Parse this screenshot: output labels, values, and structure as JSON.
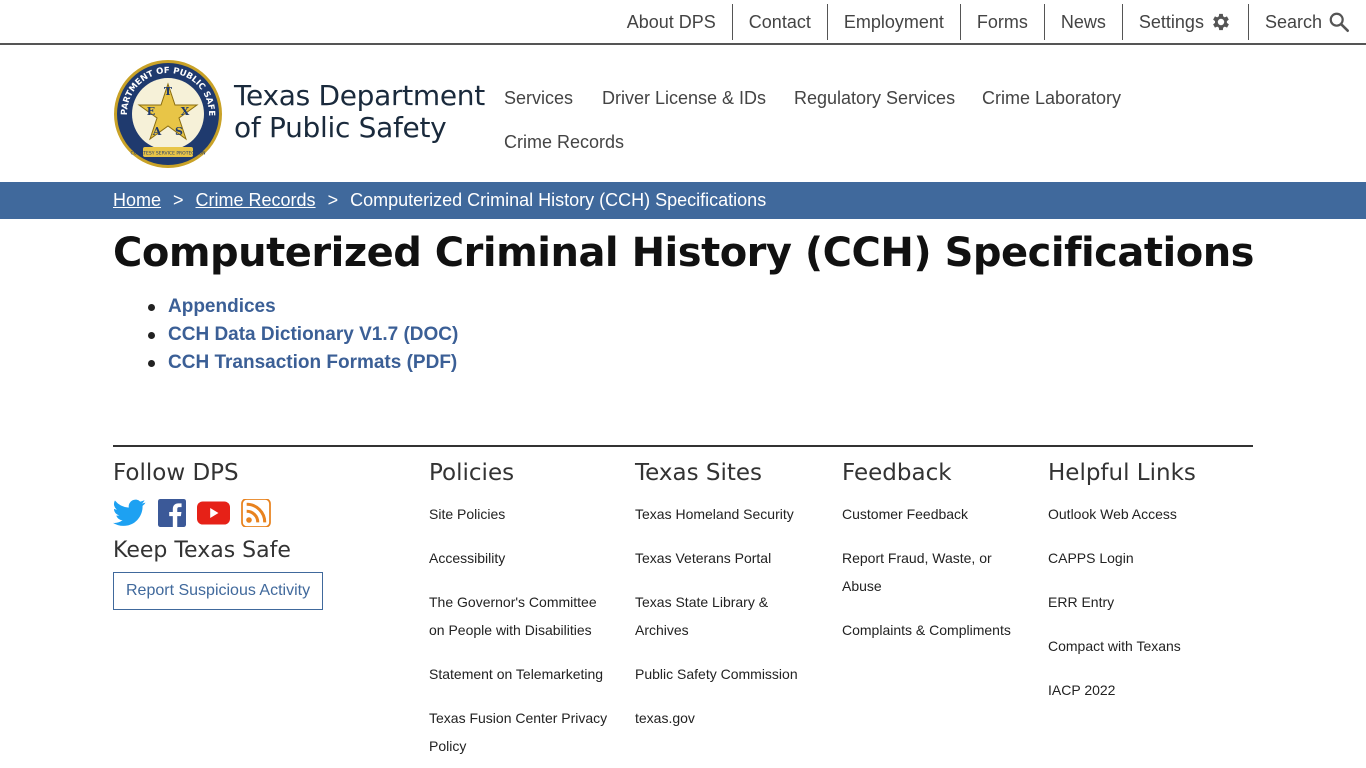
{
  "utility_nav": {
    "about": "About DPS",
    "contact": "Contact",
    "employment": "Employment",
    "forms": "Forms",
    "news": "News",
    "settings": "Settings",
    "search": "Search"
  },
  "header": {
    "logo_text": [
      "DEPARTMENT OF PUBLIC SAFETY",
      "T",
      "E",
      "X",
      "A",
      "S",
      "COURTESY SERVICE PROTECTION"
    ],
    "site_name_line1": "Texas Department",
    "site_name_line2": "of Public Safety",
    "nav": {
      "services": "Services",
      "driver_license": "Driver License & IDs",
      "regulatory": "Regulatory Services",
      "crime_lab": "Crime Laboratory",
      "crime_records": "Crime Records"
    }
  },
  "breadcrumb": {
    "home": "Home",
    "separator": ">",
    "crime_records": "Crime Records",
    "current": "Computerized Criminal History (CCH) Specifications"
  },
  "page": {
    "title": "Computerized Criminal History (CCH) Specifications",
    "documents": [
      "Appendices",
      "CCH Data Dictionary V1.7 (DOC)",
      "CCH Transaction Formats (PDF)"
    ]
  },
  "footer": {
    "follow": {
      "heading": "Follow DPS",
      "icons": [
        "twitter-icon",
        "facebook-icon",
        "youtube-icon",
        "rss-icon"
      ],
      "keep_safe": "Keep Texas Safe",
      "report_button": "Report Suspicious Activity"
    },
    "policies": {
      "heading": "Policies",
      "links": [
        "Site Policies",
        "Accessibility",
        "The Governor's Committee on People with Disabilities",
        "Statement on Telemarketing",
        "Texas Fusion Center Privacy Policy"
      ]
    },
    "texas_sites": {
      "heading": "Texas Sites",
      "links": [
        "Texas Homeland Security",
        "Texas Veterans Portal",
        "Texas State Library & Archives",
        "Public Safety Commission",
        "texas.gov"
      ]
    },
    "feedback": {
      "heading": "Feedback",
      "links": [
        "Customer Feedback",
        "Report Fraud, Waste, or Abuse",
        "Complaints & Compliments"
      ]
    },
    "helpful": {
      "heading": "Helpful Links",
      "links": [
        "Outlook Web Access",
        "CAPPS Login",
        "ERR Entry",
        "Compact with Texans",
        "IACP 2022"
      ]
    }
  },
  "colors": {
    "brand_blue": "#40699c",
    "link_blue": "#3b5f96",
    "seal_gold": "#e8c547",
    "seal_navy": "#1f3a6e"
  }
}
